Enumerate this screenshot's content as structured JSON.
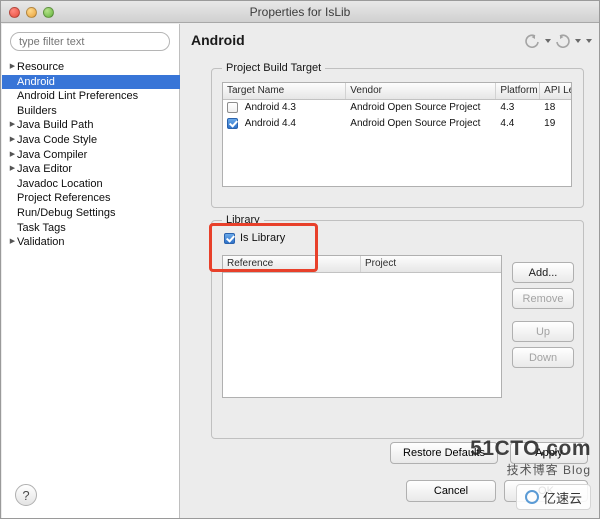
{
  "window": {
    "title": "Properties for IsLib",
    "traffic": {
      "close": "close-button",
      "minimize": "minimize-button",
      "maximize": "maximize-button"
    }
  },
  "sidebar": {
    "filter": {
      "placeholder": "type filter text",
      "value": ""
    },
    "items": [
      {
        "label": "Resource",
        "expandable": true,
        "selected": false
      },
      {
        "label": "Android",
        "expandable": false,
        "selected": true
      },
      {
        "label": "Android Lint Preferences",
        "expandable": false,
        "selected": false
      },
      {
        "label": "Builders",
        "expandable": false,
        "selected": false
      },
      {
        "label": "Java Build Path",
        "expandable": true,
        "selected": false
      },
      {
        "label": "Java Code Style",
        "expandable": true,
        "selected": false
      },
      {
        "label": "Java Compiler",
        "expandable": true,
        "selected": false
      },
      {
        "label": "Java Editor",
        "expandable": true,
        "selected": false
      },
      {
        "label": "Javadoc Location",
        "expandable": false,
        "selected": false
      },
      {
        "label": "Project References",
        "expandable": false,
        "selected": false
      },
      {
        "label": "Run/Debug Settings",
        "expandable": false,
        "selected": false
      },
      {
        "label": "Task Tags",
        "expandable": false,
        "selected": false
      },
      {
        "label": "Validation",
        "expandable": true,
        "selected": false
      }
    ]
  },
  "page": {
    "title": "Android",
    "header_icons": [
      "back-arrow-icon",
      "forward-arrow-icon",
      "menu-icon"
    ]
  },
  "build_target": {
    "legend": "Project Build Target",
    "columns": [
      "Target Name",
      "Vendor",
      "Platform",
      "API Le"
    ],
    "rows": [
      {
        "checked": false,
        "name": "Android 4.3",
        "vendor": "Android Open Source Project",
        "platform": "4.3",
        "api": "18"
      },
      {
        "checked": true,
        "name": "Android 4.4",
        "vendor": "Android Open Source Project",
        "platform": "4.4",
        "api": "19"
      }
    ]
  },
  "library": {
    "legend": "Library",
    "is_library": {
      "label": "Is Library",
      "checked": true
    },
    "columns": [
      "Reference",
      "Project"
    ],
    "rows": [],
    "buttons": [
      {
        "label": "Add...",
        "enabled": true
      },
      {
        "label": "Remove",
        "enabled": false
      },
      {
        "label": "Up",
        "enabled": false
      },
      {
        "label": "Down",
        "enabled": false
      }
    ]
  },
  "footer": {
    "restore_defaults": "Restore Defaults",
    "apply": "Apply",
    "cancel": "Cancel",
    "ok": "OK",
    "help": "?"
  },
  "watermark": {
    "main": "51CTO.com",
    "sub": "技术博客 Blog",
    "badge": "亿速云"
  },
  "colors": {
    "selection": "#3875d7",
    "highlight": "#e8402a",
    "checkbox": "#2f72c9"
  }
}
